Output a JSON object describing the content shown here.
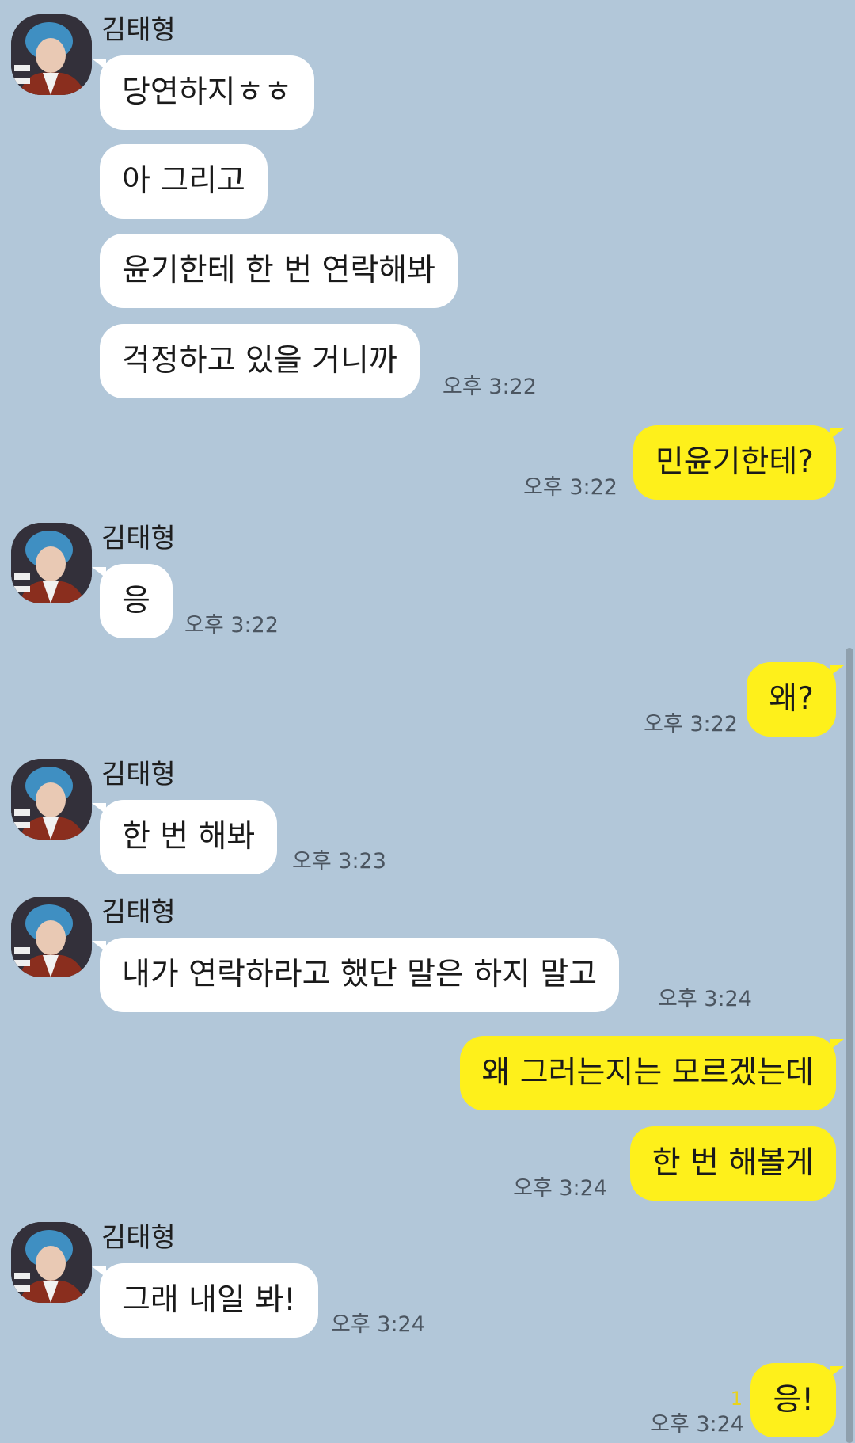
{
  "sender_name": "김태형",
  "colors": {
    "background": "#b2c7d9",
    "incoming_bubble": "#ffffff",
    "outgoing_bubble": "#fef01b"
  },
  "messages": [
    {
      "from": "them",
      "text": "당연하지ㅎㅎ"
    },
    {
      "from": "them",
      "text": "아 그리고"
    },
    {
      "from": "them",
      "text": "윤기한테 한 번 연락해봐"
    },
    {
      "from": "them",
      "text": "걱정하고 있을 거니까",
      "time": "오후 3:22"
    },
    {
      "from": "me",
      "text": "민윤기한테?",
      "time": "오후 3:22"
    },
    {
      "from": "them",
      "text": "응",
      "time": "오후 3:22"
    },
    {
      "from": "me",
      "text": "왜?",
      "time": "오후 3:22"
    },
    {
      "from": "them",
      "text": "한 번 해봐",
      "time": "오후 3:23"
    },
    {
      "from": "them",
      "text": "내가 연락하라고 했단 말은 하지 말고",
      "time": "오후 3:24"
    },
    {
      "from": "me",
      "text": "왜 그러는지는 모르겠는데"
    },
    {
      "from": "me",
      "text": "한 번 해볼게",
      "time": "오후 3:24"
    },
    {
      "from": "them",
      "text": "그래 내일 봐!",
      "time": "오후 3:24"
    },
    {
      "from": "me",
      "text": "응!",
      "time": "오후 3:24",
      "unread": "1"
    }
  ]
}
